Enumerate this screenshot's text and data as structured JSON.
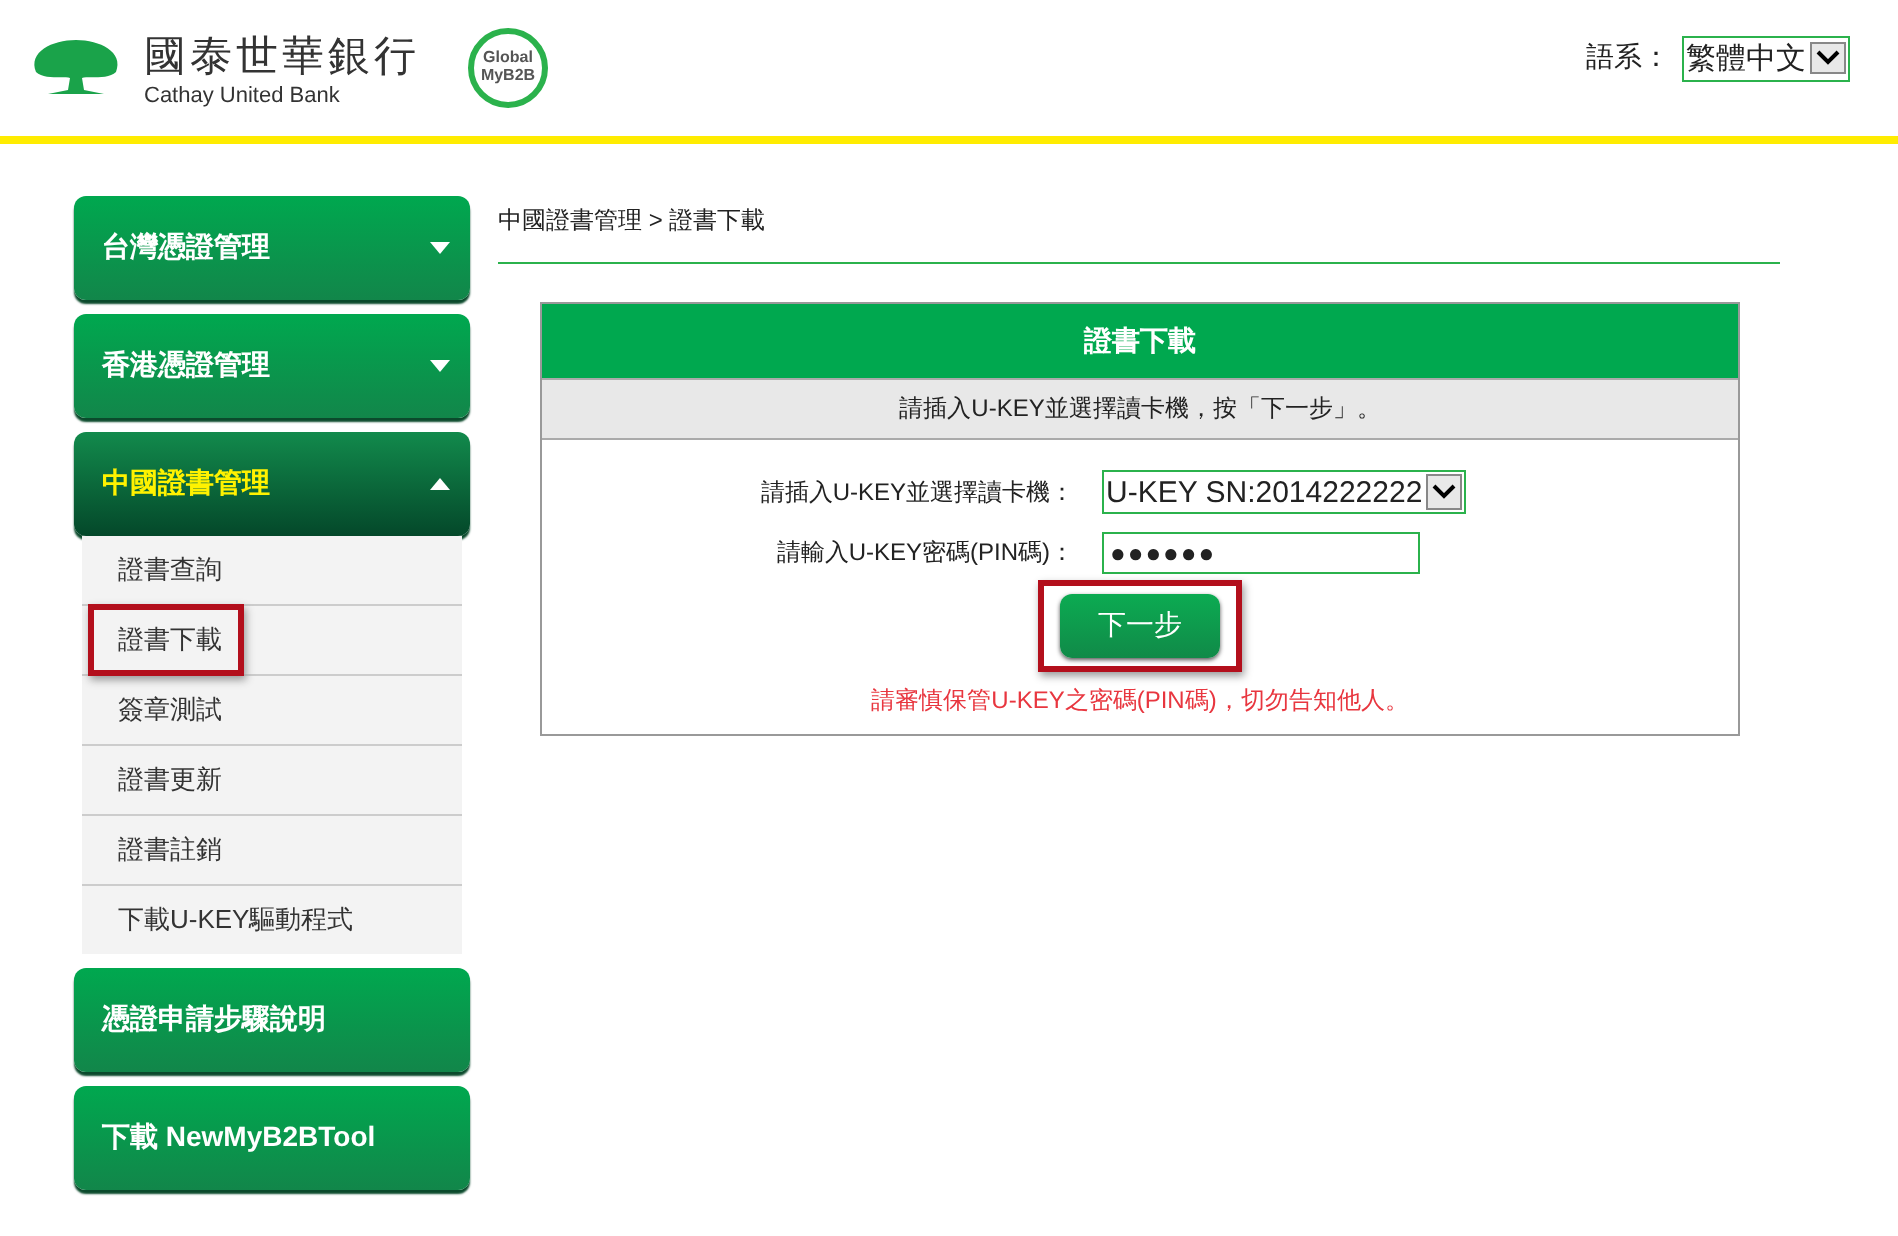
{
  "header": {
    "bank_name": "國泰世華銀行",
    "bank_name_en": "Cathay United Bank",
    "badge_line_1": "Global",
    "badge_line_2": "MyB2B",
    "language_label": "語系：",
    "language_value": "繁體中文"
  },
  "sidebar": {
    "items": [
      {
        "kind": "group",
        "label": "台灣憑證管理",
        "expanded": false,
        "active": false
      },
      {
        "kind": "group",
        "label": "香港憑證管理",
        "expanded": false,
        "active": false
      },
      {
        "kind": "group",
        "label": "中國證書管理",
        "expanded": true,
        "active": true,
        "children": [
          {
            "label": "證書查詢",
            "highlighted": false
          },
          {
            "label": "證書下載",
            "highlighted": true
          },
          {
            "label": "簽章測試",
            "highlighted": false
          },
          {
            "label": "證書更新",
            "highlighted": false
          },
          {
            "label": "證書註銷",
            "highlighted": false
          },
          {
            "label": "下載U-KEY驅動程式",
            "highlighted": false
          }
        ]
      },
      {
        "kind": "link",
        "label": "憑證申請步驟說明"
      },
      {
        "kind": "link",
        "label": "下載 NewMyB2BTool"
      }
    ]
  },
  "breadcrumb": "中國證書管理 > 證書下載",
  "panel": {
    "title": "證書下載",
    "instruction": "請插入U-KEY並選擇讀卡機，按「下一步」。",
    "fields": [
      {
        "kind": "select",
        "label": "請插入U-KEY並選擇讀卡機：",
        "value": "U-KEY SN:2014222222"
      },
      {
        "kind": "password",
        "label": "請輸入U-KEY密碼(PIN碼)：",
        "value": "●●●●●●"
      }
    ],
    "button": {
      "label": "下一步",
      "highlighted": true
    },
    "warning": "請審慎保管U-KEY之密碼(PIN碼)，切勿告知他人。"
  }
}
